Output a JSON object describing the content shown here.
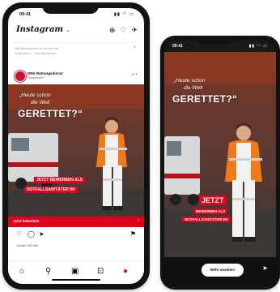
{
  "feed": {
    "status_time": "09:41",
    "status_icons": "▮▮ ◠ ▭",
    "logo": "Instagram",
    "logo_caret": "⌄",
    "icons": {
      "new": "⊕",
      "heart": "♡",
      "dm": "✈"
    },
    "suggested_line1": "Die Bundeswehr ist für dich da",
    "suggested_line2": "Gesponsert · Rettungsdienst",
    "suggested_close": "×",
    "post": {
      "account": "DRK Rettungsdienst",
      "sponsored": "Gesponsert",
      "menu": "⋯",
      "headline_1": "„Heute schon",
      "headline_2": "die Welt",
      "headline_3": "GERETTET?“",
      "tag_1": "JETZT BEWERBEN ALS",
      "tag_2": "NOTFALLSANITÄTER:IN!",
      "cta": "Jetzt bewerben",
      "cta_arrow": "›",
      "actions": {
        "like": "♡",
        "comment": "◯",
        "share": "➤",
        "save": "⚑"
      },
      "likes": "Gefällt 128 Mal"
    },
    "nav": {
      "home": "⌂",
      "search": "⚲",
      "reels": "▣",
      "shop": "⊡",
      "profile": "●"
    }
  },
  "story": {
    "status_time": "09:41",
    "status_icons": "▮▮ ◠ ▭",
    "headline_1": "„Heute schon",
    "headline_2": "die Welt",
    "headline_3": "GERETTET?“",
    "tag_big": "JETZT",
    "tag_1": "BEWERBEN ALS",
    "tag_2": "NOTFALLSANITÄTER:IN!",
    "cta": "Mehr ansehen",
    "send": "➤"
  },
  "colors": {
    "accent": "#e2001a",
    "uniform_orange": "#f07a1a",
    "uniform_white": "#f2f2f2",
    "dark": "#121212"
  }
}
